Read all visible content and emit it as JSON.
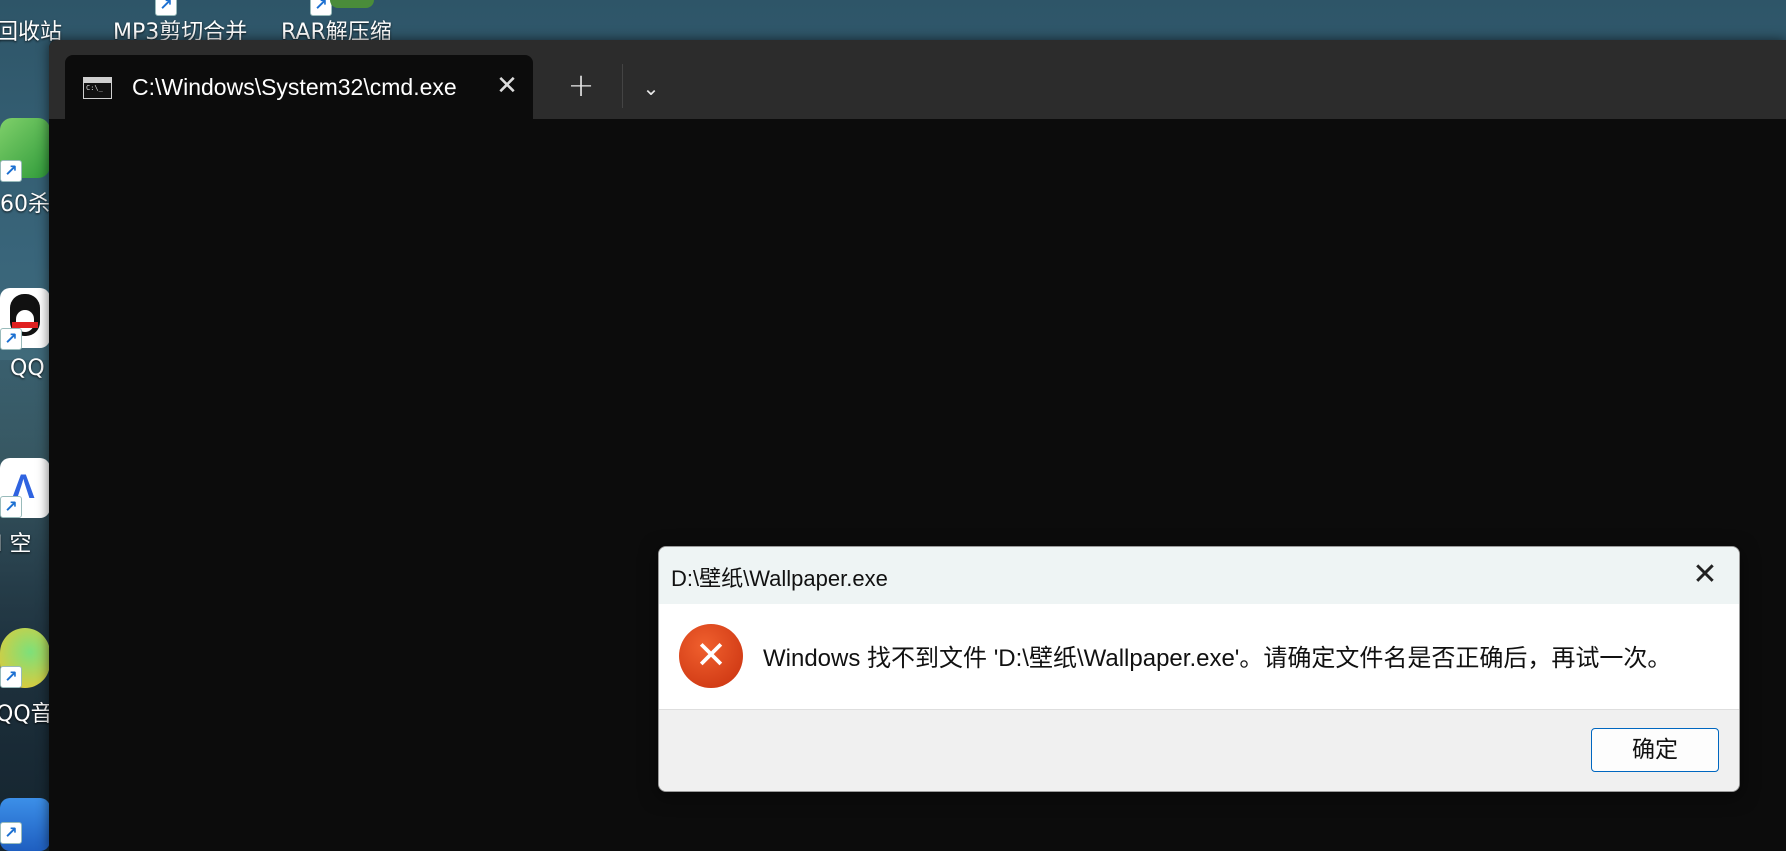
{
  "desktop": {
    "icons": [
      {
        "label": "回收站"
      },
      {
        "label": "MP3剪切合并"
      },
      {
        "label": "RAR解压缩"
      },
      {
        "label": "60杀"
      },
      {
        "label": "QQ"
      },
      {
        "label": "I 空"
      },
      {
        "label": "QQ音"
      }
    ]
  },
  "terminal": {
    "tab_title": "C:\\Windows\\System32\\cmd.exe",
    "close_glyph": "✕",
    "new_tab_glyph": "+",
    "dropdown_glyph": "⌄"
  },
  "dialog": {
    "title": "D:\\壁纸\\Wallpaper.exe",
    "close_glyph": "✕",
    "icon_glyph": "✕",
    "message": "Windows 找不到文件 'D:\\壁纸\\Wallpaper.exe'。请确定文件名是否正确后，再试一次。",
    "ok_label": "确定"
  },
  "colors": {
    "accent": "#0067c0",
    "error": "#d9421a",
    "terminal_bg": "#0c0c0c",
    "tabbar_bg": "#2c2c2c"
  }
}
